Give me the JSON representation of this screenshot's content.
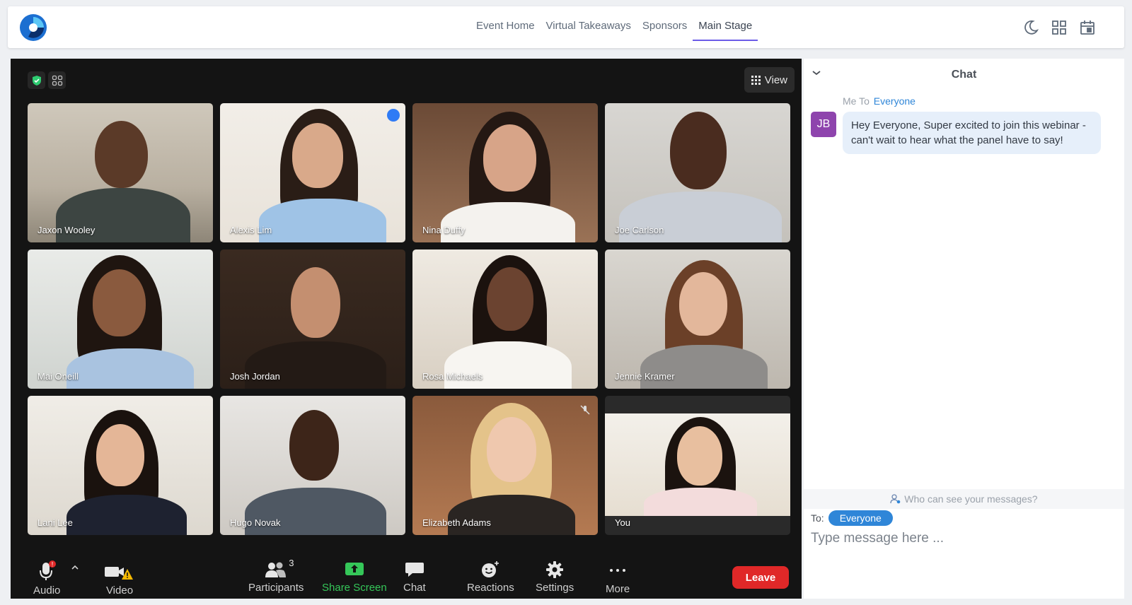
{
  "nav": {
    "items": [
      {
        "label": "Event Home"
      },
      {
        "label": "Virtual Takeaways"
      },
      {
        "label": "Sponsors"
      },
      {
        "label": "Main Stage",
        "active": true
      }
    ]
  },
  "top_icons": [
    "moon-icon",
    "grid-icon",
    "calendar-icon"
  ],
  "stage": {
    "view_label": "View",
    "participants": [
      {
        "name": "Jaxon Wooley"
      },
      {
        "name": "Alexis Lim",
        "speaking": true
      },
      {
        "name": "Nina Duffy"
      },
      {
        "name": "Joe Carlson"
      },
      {
        "name": "Mai Oneill"
      },
      {
        "name": "Josh Jordan"
      },
      {
        "name": "Rosa Michaels"
      },
      {
        "name": "Jennie Kramer"
      },
      {
        "name": "Lani Lee"
      },
      {
        "name": "Hugo Novak"
      },
      {
        "name": "Elizabeth Adams",
        "muted": true
      },
      {
        "name": "You"
      }
    ]
  },
  "controls": {
    "audio_label": "Audio",
    "audio_badge": "!",
    "video_label": "Video",
    "participants_label": "Participants",
    "participants_count": "3",
    "share_label": "Share Screen",
    "chat_label": "Chat",
    "reactions_label": "Reactions",
    "settings_label": "Settings",
    "more_label": "More",
    "leave_label": "Leave"
  },
  "chat": {
    "title": "Chat",
    "message": {
      "sender": "Me",
      "to_word": "To",
      "recipient": "Everyone",
      "initials": "JB",
      "text": "Hey Everyone, Super excited to join this webinar - can't wait to hear what the panel have to say!"
    },
    "who_can_see": "Who can see your messages?",
    "to_label": "To:",
    "to_value": "Everyone",
    "input_placeholder": "Type message here ..."
  },
  "colors": {
    "accent": "#6c5ce7",
    "leave": "#e02828",
    "share": "#35c759",
    "chip": "#2f86d8",
    "avatar": "#8e44ad"
  }
}
